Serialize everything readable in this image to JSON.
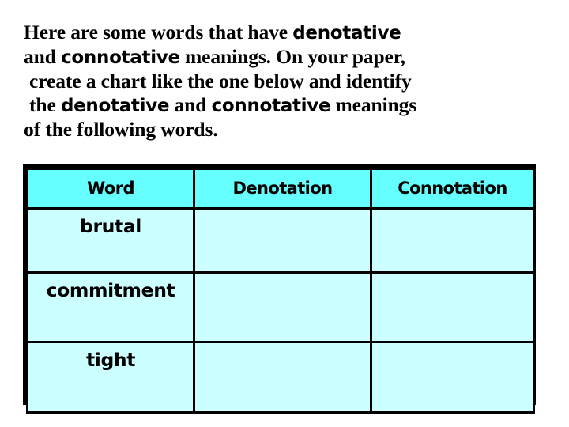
{
  "slide": {
    "background_color": "#ffffff",
    "prompt": {
      "lines": [
        [
          {
            "text": "Here are some words that have ",
            "style": "serif"
          },
          {
            "text": "denotative",
            "style": "sans"
          }
        ],
        [
          {
            "text": "and ",
            "style": "serif"
          },
          {
            "text": "connotative",
            "style": "sans"
          },
          {
            "text": " meanings.  On your paper,",
            "style": "serif"
          }
        ],
        [
          {
            "text": "create a chart like the one below and identify",
            "style": "serif"
          }
        ],
        [
          {
            "text": "the ",
            "style": "serif"
          },
          {
            "text": "denotative",
            "style": "sans"
          },
          {
            "text": " and ",
            "style": "serif"
          },
          {
            "text": "connotative",
            "style": "sans"
          },
          {
            "text": " meanings",
            "style": "serif"
          }
        ],
        [
          {
            "text": "of the following words.",
            "style": "serif"
          }
        ]
      ],
      "plain_text": "Here are some words that have denotative and connotative meanings.  On your paper, create a chart like the one below and identify the denotative and connotative meanings of the following words."
    },
    "chart": {
      "header_background": "#66ffff",
      "cell_background": "#ccffff",
      "border_color": "#000000",
      "headers": [
        "Word",
        "Denotation",
        "Connotation"
      ],
      "rows": [
        {
          "word": "brutal",
          "denotation": "",
          "connotation": ""
        },
        {
          "word": "commitment",
          "denotation": "",
          "connotation": ""
        },
        {
          "word": "tight",
          "denotation": "",
          "connotation": ""
        }
      ]
    }
  }
}
